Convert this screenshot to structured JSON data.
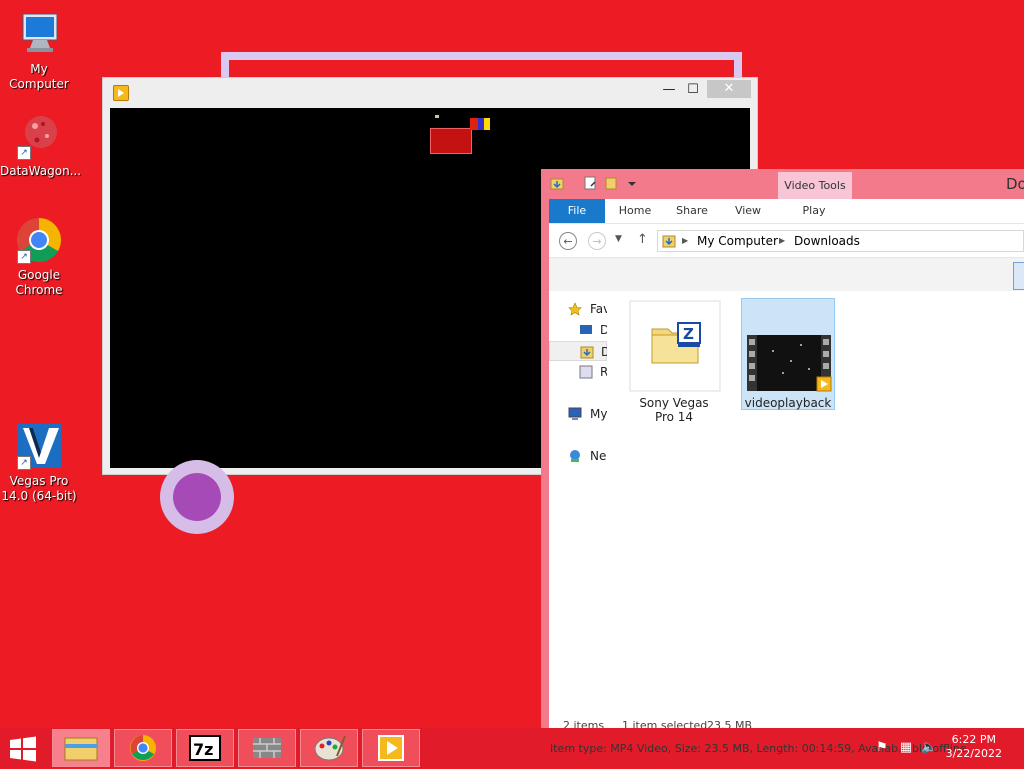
{
  "desktop": {
    "icons": [
      {
        "label": "My Computer",
        "icon": "computer-icon"
      },
      {
        "label": "DataWagon...",
        "icon": "datawagon-icon"
      },
      {
        "label": "Google Chrome",
        "icon": "chrome-icon"
      },
      {
        "label": "Vegas Pro 14.0 (64-bit)",
        "icon": "vegas-pro-icon"
      }
    ]
  },
  "player": {
    "minimize": "—",
    "maximize": "☐",
    "close": "✕"
  },
  "explorer": {
    "title": "Do",
    "contextual_tab": "Video Tools",
    "tabs": [
      "File",
      "Home",
      "Share",
      "View",
      "Play"
    ],
    "address": {
      "segments": [
        "My Computer",
        "Downloads"
      ]
    },
    "navpane": [
      {
        "label": "Fav",
        "icon": "star-icon"
      },
      {
        "label": "D",
        "icon": "desktop-icon"
      },
      {
        "label": "D",
        "icon": "downloads-icon"
      },
      {
        "label": "R",
        "icon": "recent-icon"
      },
      {
        "label": "My",
        "icon": "computer-icon"
      },
      {
        "label": "Ne",
        "icon": "network-icon"
      }
    ],
    "files": [
      {
        "name": "Sony Vegas Pro 14",
        "icon": "zip-folder-icon",
        "selected": false
      },
      {
        "name": "videoplayback",
        "icon": "video-thumbnail-icon",
        "selected": true
      }
    ],
    "status": {
      "items": "2 items",
      "selected": "1 item selected",
      "size": "23.5 MB"
    }
  },
  "taskbar": {
    "tooltip": "Item type: MP4 Video, Size: 23.5 MB, Length: 00:14:59, Availab... ble offline",
    "time": "6:22 PM",
    "date": "3/22/2022",
    "buttons": [
      "file-explorer-icon",
      "chrome-icon",
      "7zip-icon",
      "firewall-icon",
      "paint-icon",
      "media-player-icon"
    ]
  },
  "colors": {
    "desktop": "#ed1c24",
    "taskbar": "#e21b2a",
    "explorer_frame": "#f27a8a",
    "ribbon_file": "#1979ca",
    "selection": "#cce4f7"
  }
}
